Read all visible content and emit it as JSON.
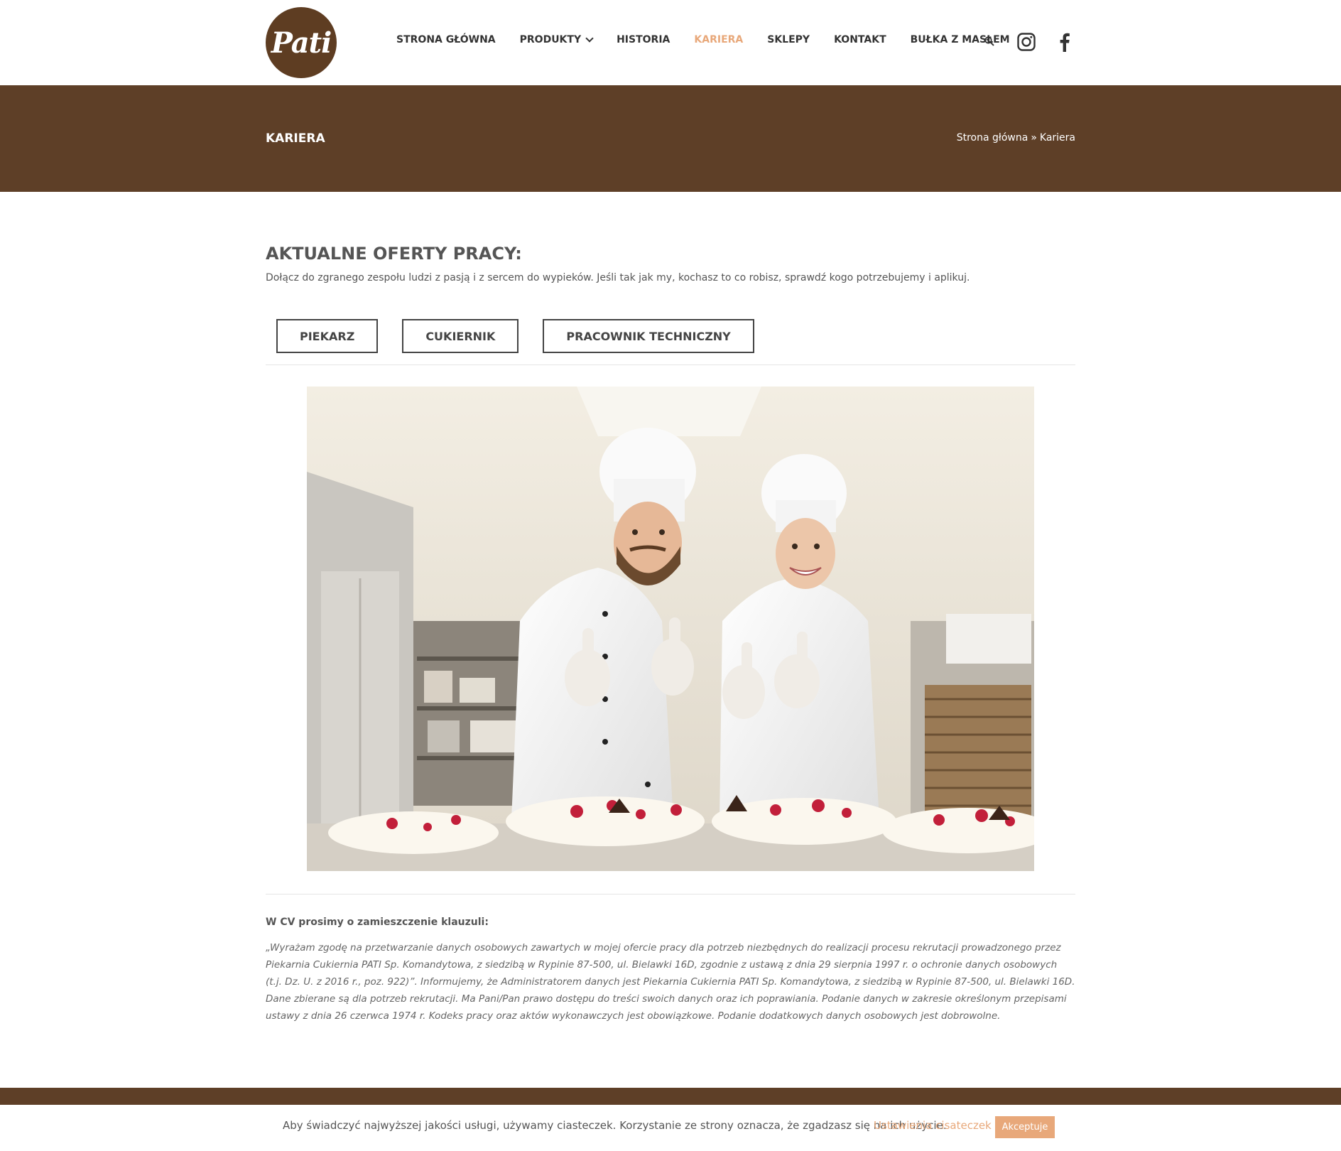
{
  "header": {
    "logo_text": "Pati",
    "nav": [
      {
        "label": "STRONA GŁÓWNA"
      },
      {
        "label": "PRODUKTY"
      },
      {
        "label": "HISTORIA"
      },
      {
        "label": "KARIERA"
      },
      {
        "label": "SKLEPY"
      },
      {
        "label": "KONTAKT"
      },
      {
        "label": "BUŁKA Z MASŁEM"
      }
    ],
    "active_index": 3
  },
  "title_bar": {
    "title": "KARIERA",
    "breadcrumb_home": "Strona główna",
    "breadcrumb_sep": "»",
    "breadcrumb_current": "Kariera"
  },
  "main": {
    "heading": "AKTUALNE OFERTY PRACY:",
    "intro": "Dołącz do zgranego zespołu ludzi z pasją i z sercem do wypieków. Jeśli tak jak my, kochasz to co robisz, sprawdź kogo potrzebujemy i aplikuj.",
    "tabs": [
      {
        "label": "PIEKARZ"
      },
      {
        "label": "CUKIERNIK"
      },
      {
        "label": "PRACOWNIK TECHNICZNY"
      }
    ],
    "cv_heading": "W CV prosimy o zamieszczenie klauzuli:",
    "clause": "„Wyrażam zgodę na przetwarzanie danych osobowych zawartych w mojej ofercie pracy dla potrzeb niezbędnych do realizacji procesu rekrutacji prowadzonego przez Piekarnia Cukiernia PATI Sp. Komandytowa, z siedzibą w Rypinie 87-500, ul. Bielawki 16D, zgodnie z ustawą z dnia 29 sierpnia 1997 r. o ochronie danych osobowych (t.j. Dz. U. z 2016 r., poz. 922)”. Informujemy, że Administratorem danych jest Piekarnia Cukiernia PATI Sp. Komandytowa, z siedzibą w Rypinie 87-500, ul. Bielawki 16D. Dane zbierane są dla potrzeb rekrutacji. Ma Pani/Pan prawo dostępu do treści swoich danych oraz ich poprawiania. Podanie danych w zakresie określonym przepisami ustawy z dnia 26 czerwca 1974 r. Kodeks pracy oraz aktów wykonawczych jest obowiązkowe. Podanie dodatkowych danych osobowych jest dobrowolne."
  },
  "cookie": {
    "text": "Aby świadczyć najwyższej jakości usługi, używamy ciasteczek. Korzystanie ze strony oznacza, że zgadzasz się na ich użycie.",
    "settings": "Ustawienia cisateczek",
    "accept": "Akceptuje"
  },
  "colors": {
    "brand_brown": "#5e3f27",
    "accent": "#e8a87a"
  },
  "icons": [
    "search-icon",
    "instagram-icon",
    "facebook-icon",
    "chevron-down-icon"
  ]
}
